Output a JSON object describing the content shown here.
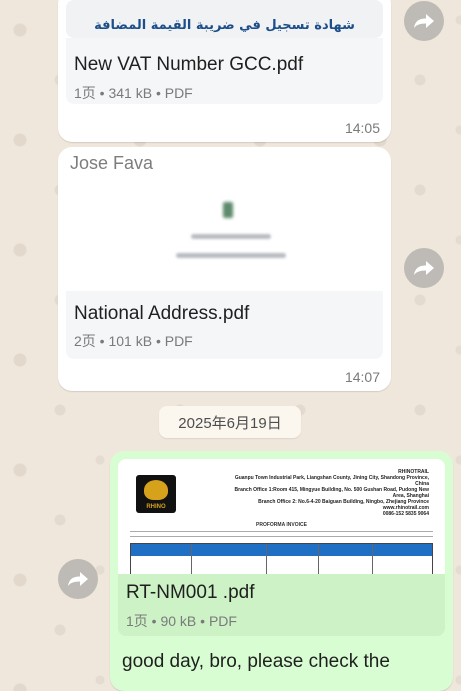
{
  "messages": {
    "doc1": {
      "preview_title": "شهادة تسجيل في ضريبة القيمة المضافة",
      "file_name": "New VAT Number GCC.pdf",
      "file_info": "1页 • 341 kB • PDF",
      "time": "14:05"
    },
    "doc2": {
      "sender": "Jose Fava",
      "file_name": "National Address.pdf",
      "file_info": "2页 • 101 kB • PDF",
      "time": "14:07"
    },
    "date_separator": "2025年6月19日",
    "doc3": {
      "header_company": "RHINOTRAIL",
      "header_address_1": "Guanpu Town Industrial Park, Liangshan County, Jining City, Shandong Province, China",
      "header_address_2": "Branch Office 1:Room 415, Mingyue Building, No. 500 Gushan Road, Pudong New Area, Shanghai",
      "header_address_3": "Branch Office 2: No.6-4-20 Baiguan Building, Ningbo, Zhejiang Province",
      "header_web": "www.rhinotrail.com",
      "header_phone": "0086-152 5835 9064",
      "logo_text": "RHINO",
      "invoice_title": "PROFORMA INVOICE",
      "file_name": "RT-NM001 .pdf",
      "file_info": "1页 • 90 kB • PDF",
      "text": "good day, bro, please check the"
    }
  },
  "colors": {
    "outgoing_bubble": "#d9fdd3",
    "incoming_bubble": "#ffffff",
    "chat_background": "#efe7dc",
    "pdf_table_header": "#1f6fc5"
  },
  "icons": {
    "forward": "forward-arrow-icon"
  }
}
